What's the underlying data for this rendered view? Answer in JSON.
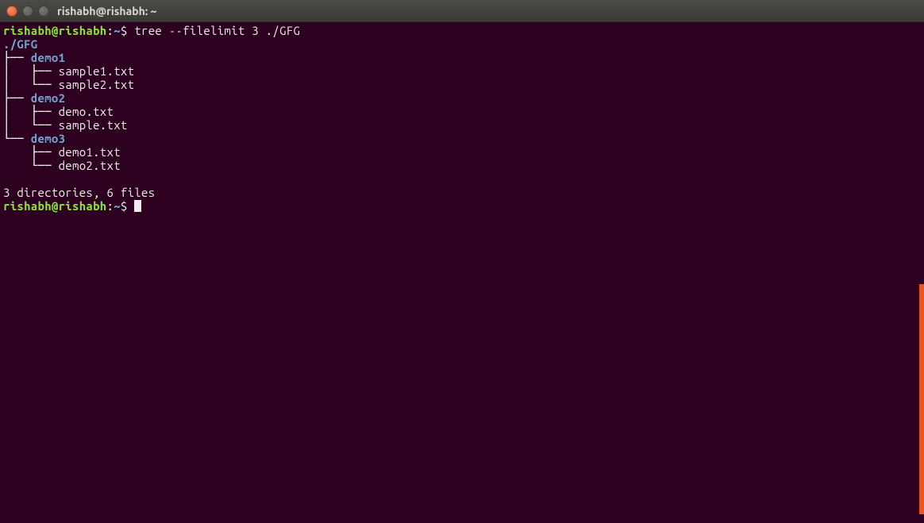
{
  "window": {
    "title": "rishabh@rishabh: ~"
  },
  "prompt": {
    "user_host": "rishabh@rishabh",
    "colon": ":",
    "path": "~",
    "symbol": "$"
  },
  "command": "tree --filelimit 3 ./GFG",
  "tree": {
    "root": "./GFG",
    "lines": [
      {
        "prefix": "├── ",
        "name": "demo1",
        "type": "dir"
      },
      {
        "prefix": "│   ├── ",
        "name": "sample1.txt",
        "type": "file"
      },
      {
        "prefix": "│   └── ",
        "name": "sample2.txt",
        "type": "file"
      },
      {
        "prefix": "├── ",
        "name": "demo2",
        "type": "dir"
      },
      {
        "prefix": "│   ├── ",
        "name": "demo.txt",
        "type": "file"
      },
      {
        "prefix": "│   └── ",
        "name": "sample.txt",
        "type": "file"
      },
      {
        "prefix": "└── ",
        "name": "demo3",
        "type": "dir"
      },
      {
        "prefix": "    ├── ",
        "name": "demo1.txt",
        "type": "file"
      },
      {
        "prefix": "    └── ",
        "name": "demo2.txt",
        "type": "file"
      }
    ]
  },
  "summary": "3 directories, 6 files"
}
